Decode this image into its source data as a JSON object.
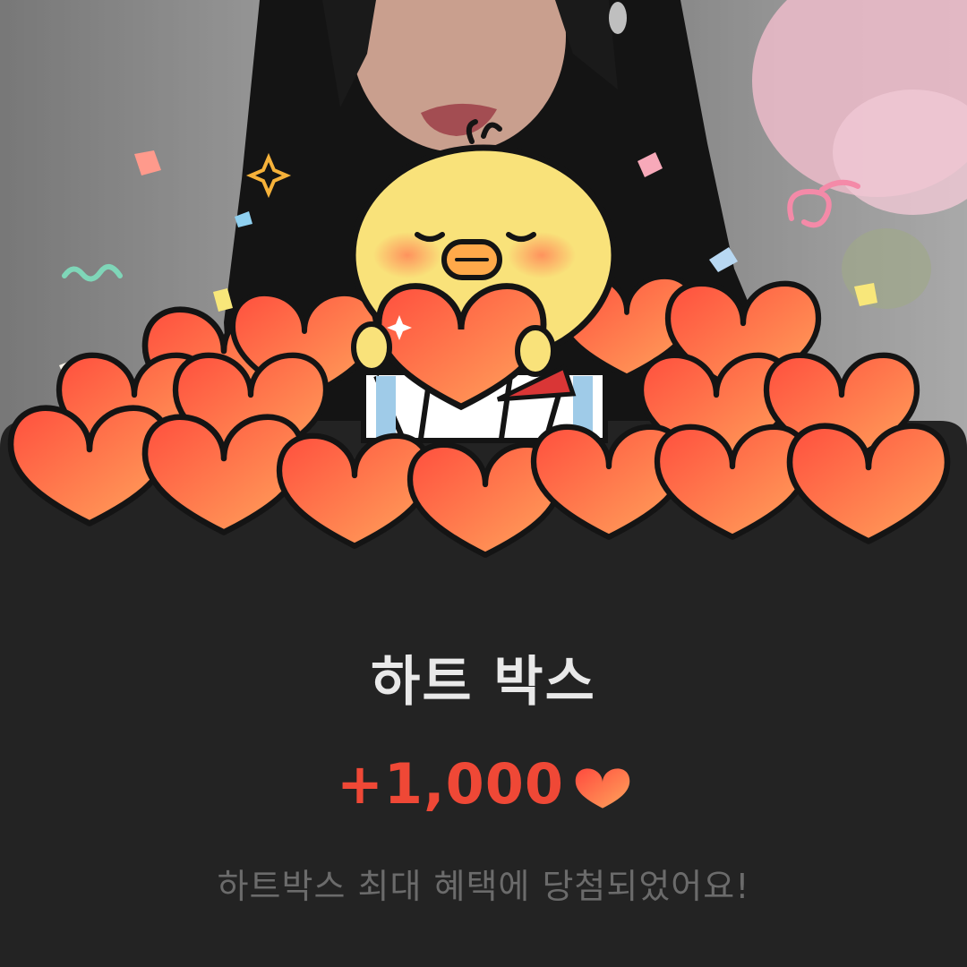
{
  "reward": {
    "title": "하트 박스",
    "amount": "+1,000",
    "message": "하트박스 최대 혜택에 당첨되었어요!",
    "amount_icon": "heart-icon"
  },
  "illustration": {
    "character": "yellow-chick",
    "item": "heart-pile",
    "decoration": "confetti"
  },
  "colors": {
    "sheet_background": "#232323",
    "title": "#e9e9e9",
    "amount": "#ef4836",
    "message": "#6b6b6b",
    "heart_top": "#ff5a3c",
    "heart_bottom": "#ffa25a",
    "chick": "#f9e27a"
  }
}
